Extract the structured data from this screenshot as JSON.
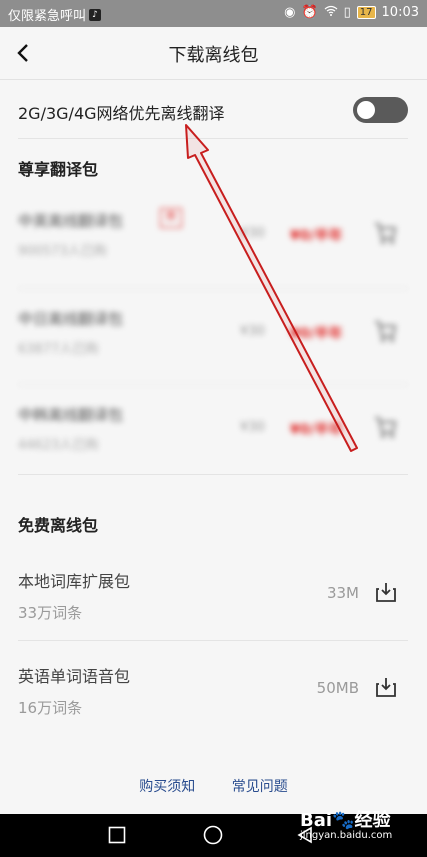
{
  "status_bar": {
    "carrier_text": "仅限紧急呼叫",
    "battery": "17",
    "time": "10:03"
  },
  "header": {
    "title": "下载离线包"
  },
  "settings": {
    "mobile_offline_label": "2G/3G/4G网络优先离线翻译",
    "mobile_offline_enabled": false
  },
  "premium_section": {
    "title": "尊享翻译包",
    "items": [
      {
        "name": "中英离线翻译包",
        "sold": "900573人已购",
        "old_price": "¥30",
        "new_price": "¥0/半年"
      },
      {
        "name": "中日离线翻译包",
        "sold": "63877人已购",
        "old_price": "¥30",
        "new_price": "¥0/半年"
      },
      {
        "name": "中韩离线翻译包",
        "sold": "44623人已购",
        "old_price": "¥30",
        "new_price": "¥0/半年"
      }
    ]
  },
  "free_section": {
    "title": "免费离线包",
    "items": [
      {
        "name": "本地词库扩展包",
        "subtitle": "33万词条",
        "size": "33M"
      },
      {
        "name": "英语单词语音包",
        "subtitle": "16万词条",
        "size": "50MB"
      }
    ]
  },
  "footer": {
    "purchase_notice": "购买须知",
    "faq": "常见问题"
  },
  "watermark": {
    "brand": "Bai",
    "brand_suffix": "经验",
    "site": "jingyan.baidu.com"
  },
  "colors": {
    "accent_link": "#2a4d8f",
    "price_red": "#e1302e",
    "annotation_red": "#c81e1e"
  }
}
